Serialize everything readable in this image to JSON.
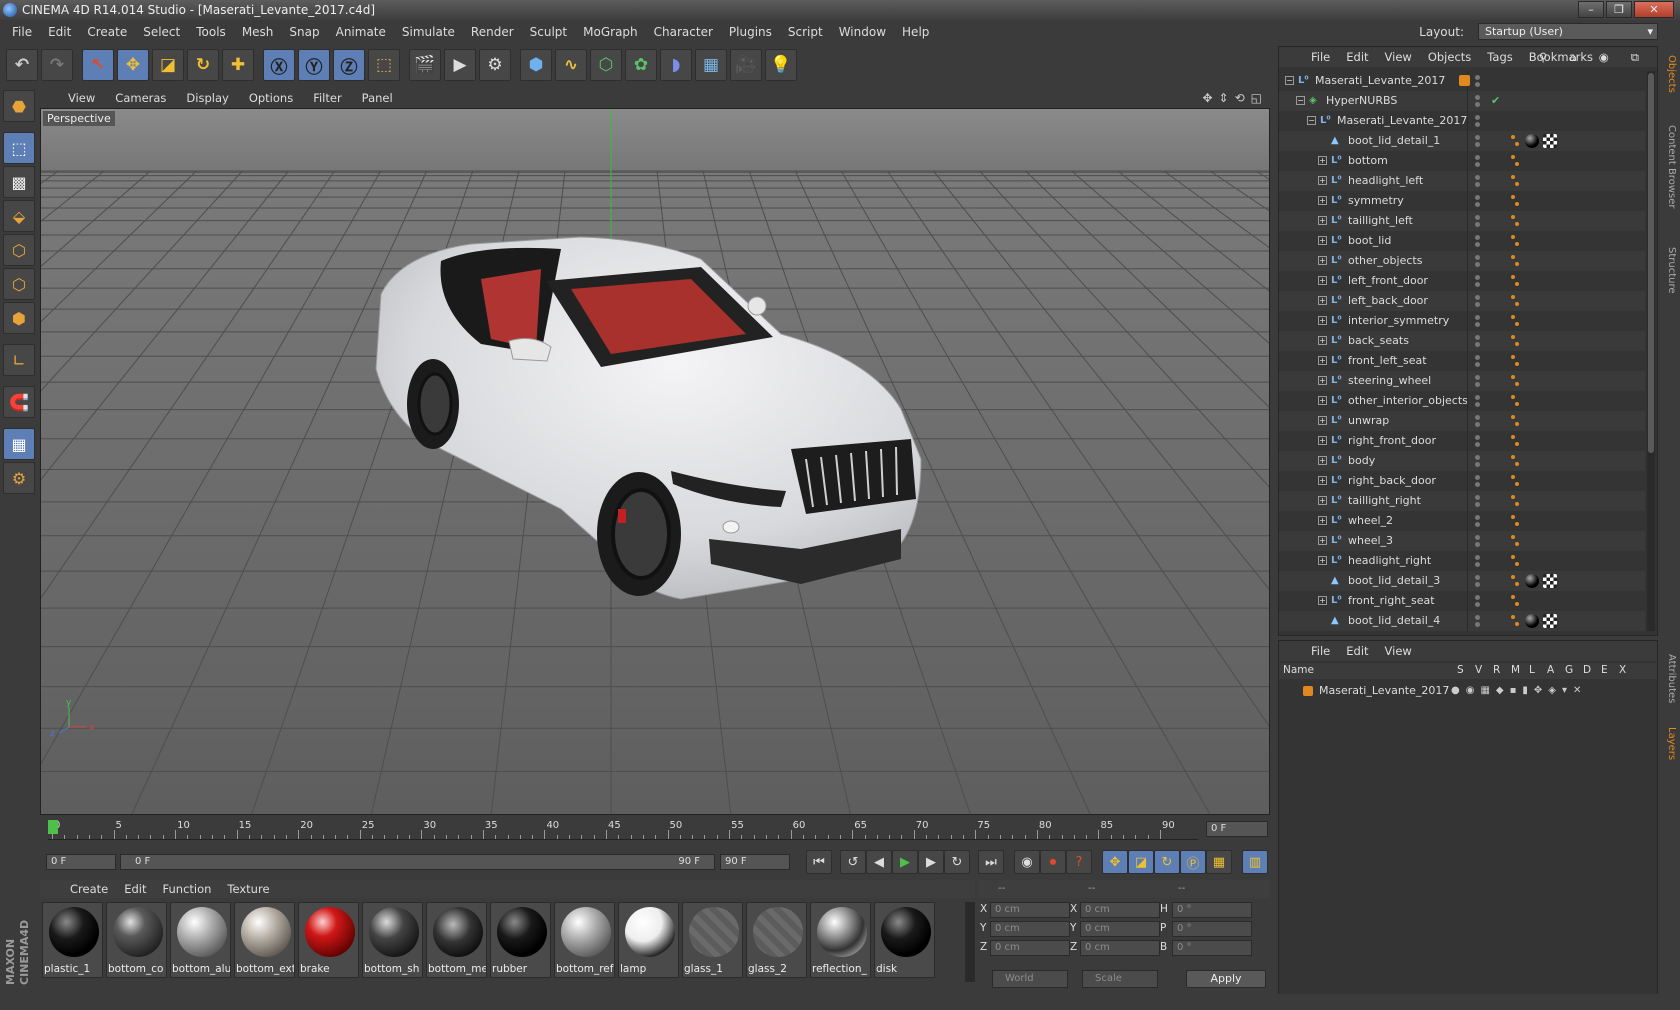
{
  "window": {
    "title": "CINEMA 4D R14.014 Studio - [Maserati_Levante_2017.c4d]"
  },
  "menu": [
    "File",
    "Edit",
    "Create",
    "Select",
    "Tools",
    "Mesh",
    "Snap",
    "Animate",
    "Simulate",
    "Render",
    "Sculpt",
    "MoGraph",
    "Character",
    "Plugins",
    "Script",
    "Window",
    "Help"
  ],
  "layout": {
    "label": "Layout:",
    "value": "Startup (User)"
  },
  "viewport": {
    "menu": [
      "View",
      "Cameras",
      "Display",
      "Options",
      "Filter",
      "Panel"
    ],
    "label": "Perspective"
  },
  "timeline": {
    "ticks": [
      "0",
      "5",
      "10",
      "15",
      "20",
      "25",
      "30",
      "35",
      "40",
      "45",
      "50",
      "55",
      "60",
      "65",
      "70",
      "75",
      "80",
      "85",
      "90"
    ],
    "end_field": "0 F",
    "start": "0 F",
    "range_start": "0 F",
    "range_end": "90 F",
    "end": "90 F"
  },
  "materials": {
    "menu": [
      "Create",
      "Edit",
      "Function",
      "Texture"
    ],
    "items": [
      {
        "name": "plastic_1",
        "shade": "black"
      },
      {
        "name": "bottom_co",
        "shade": "darkgray"
      },
      {
        "name": "bottom_alu",
        "shade": "silver"
      },
      {
        "name": "bottom_ext",
        "shade": "warmsilver"
      },
      {
        "name": "brake",
        "shade": "red"
      },
      {
        "name": "bottom_sh",
        "shade": "darkchrome"
      },
      {
        "name": "bottom_me",
        "shade": "darkchrome2"
      },
      {
        "name": "rubber",
        "shade": "black"
      },
      {
        "name": "bottom_ref",
        "shade": "silver"
      },
      {
        "name": "lamp",
        "shade": "white"
      },
      {
        "name": "glass_1",
        "shade": "glass"
      },
      {
        "name": "glass_2",
        "shade": "glass"
      },
      {
        "name": "reflection_",
        "shade": "chrome"
      },
      {
        "name": "disk",
        "shade": "black"
      }
    ]
  },
  "coords": {
    "headers": [
      "--",
      "--",
      "--"
    ],
    "rows": [
      {
        "a": "X",
        "av": "0 cm",
        "b": "X",
        "bv": "0 cm",
        "c": "H",
        "cv": "0 °"
      },
      {
        "a": "Y",
        "av": "0 cm",
        "b": "Y",
        "bv": "0 cm",
        "c": "P",
        "cv": "0 °"
      },
      {
        "a": "Z",
        "av": "0 cm",
        "b": "Z",
        "bv": "0 cm",
        "c": "B",
        "cv": "0 °"
      }
    ],
    "world": "World",
    "scale": "Scale",
    "apply": "Apply"
  },
  "objects": {
    "menu": [
      "File",
      "Edit",
      "View",
      "Objects",
      "Tags",
      "Bookmarks"
    ],
    "rows": [
      {
        "name": "Maserati_Levante_2017",
        "depth": 0,
        "type": "null",
        "expander": "−",
        "tag": "orange"
      },
      {
        "name": "HyperNURBS",
        "depth": 1,
        "type": "nurbs",
        "expander": "−",
        "tag": "check"
      },
      {
        "name": "Maserati_Levante_2017",
        "depth": 2,
        "type": "null",
        "expander": "−",
        "tag": ""
      },
      {
        "name": "boot_lid_detail_1",
        "depth": 3,
        "type": "poly",
        "expander": "",
        "tag": "mat"
      },
      {
        "name": "bottom",
        "depth": 3,
        "type": "null",
        "expander": "+",
        "tag": "dot"
      },
      {
        "name": "headlight_left",
        "depth": 3,
        "type": "null",
        "expander": "+",
        "tag": "dot"
      },
      {
        "name": "symmetry",
        "depth": 3,
        "type": "null",
        "expander": "+",
        "tag": "dot"
      },
      {
        "name": "taillight_left",
        "depth": 3,
        "type": "null",
        "expander": "+",
        "tag": "dot"
      },
      {
        "name": "boot_lid",
        "depth": 3,
        "type": "null",
        "expander": "+",
        "tag": "dot"
      },
      {
        "name": "other_objects",
        "depth": 3,
        "type": "null",
        "expander": "+",
        "tag": "dot"
      },
      {
        "name": "left_front_door",
        "depth": 3,
        "type": "null",
        "expander": "+",
        "tag": "dot"
      },
      {
        "name": "left_back_door",
        "depth": 3,
        "type": "null",
        "expander": "+",
        "tag": "dot"
      },
      {
        "name": "interior_symmetry",
        "depth": 3,
        "type": "null",
        "expander": "+",
        "tag": "dot"
      },
      {
        "name": "back_seats",
        "depth": 3,
        "type": "null",
        "expander": "+",
        "tag": "dot"
      },
      {
        "name": "front_left_seat",
        "depth": 3,
        "type": "null",
        "expander": "+",
        "tag": "dot"
      },
      {
        "name": "steering_wheel",
        "depth": 3,
        "type": "null",
        "expander": "+",
        "tag": "dot"
      },
      {
        "name": "other_interior_objects",
        "depth": 3,
        "type": "null",
        "expander": "+",
        "tag": "dot"
      },
      {
        "name": "unwrap",
        "depth": 3,
        "type": "null",
        "expander": "+",
        "tag": "dot"
      },
      {
        "name": "right_front_door",
        "depth": 3,
        "type": "null",
        "expander": "+",
        "tag": "dot"
      },
      {
        "name": "body",
        "depth": 3,
        "type": "null",
        "expander": "+",
        "tag": "dot"
      },
      {
        "name": "right_back_door",
        "depth": 3,
        "type": "null",
        "expander": "+",
        "tag": "dot"
      },
      {
        "name": "taillight_right",
        "depth": 3,
        "type": "null",
        "expander": "+",
        "tag": "dot"
      },
      {
        "name": "wheel_2",
        "depth": 3,
        "type": "null",
        "expander": "+",
        "tag": "dot"
      },
      {
        "name": "wheel_3",
        "depth": 3,
        "type": "null",
        "expander": "+",
        "tag": "dot"
      },
      {
        "name": "headlight_right",
        "depth": 3,
        "type": "null",
        "expander": "+",
        "tag": "dot"
      },
      {
        "name": "boot_lid_detail_3",
        "depth": 3,
        "type": "poly",
        "expander": "",
        "tag": "mat"
      },
      {
        "name": "front_right_seat",
        "depth": 3,
        "type": "null",
        "expander": "+",
        "tag": "dot"
      },
      {
        "name": "boot_lid_detail_4",
        "depth": 3,
        "type": "poly",
        "expander": "",
        "tag": "mat"
      }
    ]
  },
  "layers": {
    "menu": [
      "File",
      "Edit",
      "View"
    ],
    "headers": [
      "Name",
      "S",
      "V",
      "R",
      "M",
      "L",
      "A",
      "G",
      "D",
      "E",
      "X"
    ],
    "row": "Maserati_Levante_2017"
  },
  "sidetabs": [
    "Objects",
    "Content Browser",
    "Structure",
    "Attributes",
    "Layers"
  ],
  "colors": {
    "accent": "#5d7fb5",
    "tag": "#e0891f",
    "play": "#4ec04a"
  }
}
